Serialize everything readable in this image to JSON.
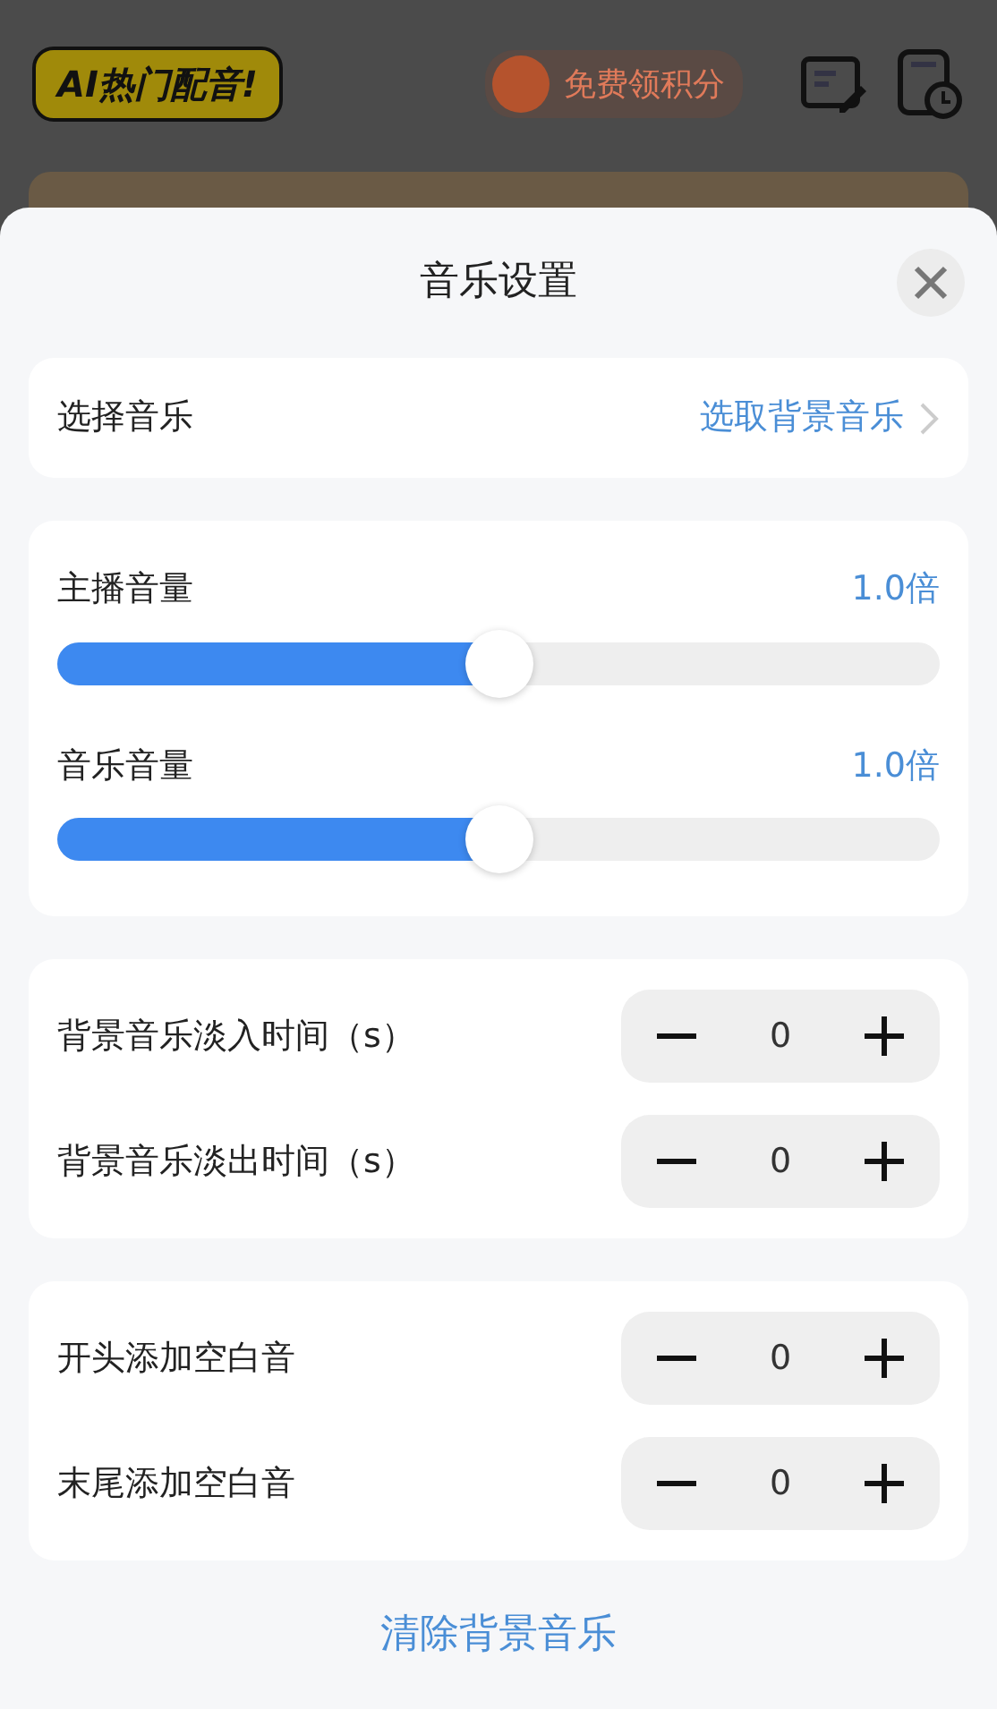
{
  "app_header": {
    "logo": "AI热门配音!",
    "points_button": "免费领积分"
  },
  "sheet": {
    "title": "音乐设置",
    "music_select": {
      "label": "选择音乐",
      "value": "选取背景音乐"
    },
    "volumes": [
      {
        "label": "主播音量",
        "reading": "1.0倍",
        "level": 0.5
      },
      {
        "label": "音乐音量",
        "reading": "1.0倍",
        "level": 0.5
      }
    ],
    "stepper_groups": [
      [
        {
          "label": "背景音乐淡入时间（s）",
          "value": "0"
        },
        {
          "label": "背景音乐淡出时间（s）",
          "value": "0"
        }
      ],
      [
        {
          "label": "开头添加空白音",
          "value": "0"
        },
        {
          "label": "末尾添加空白音",
          "value": "0"
        }
      ]
    ],
    "clear_link": "清除背景音乐"
  }
}
